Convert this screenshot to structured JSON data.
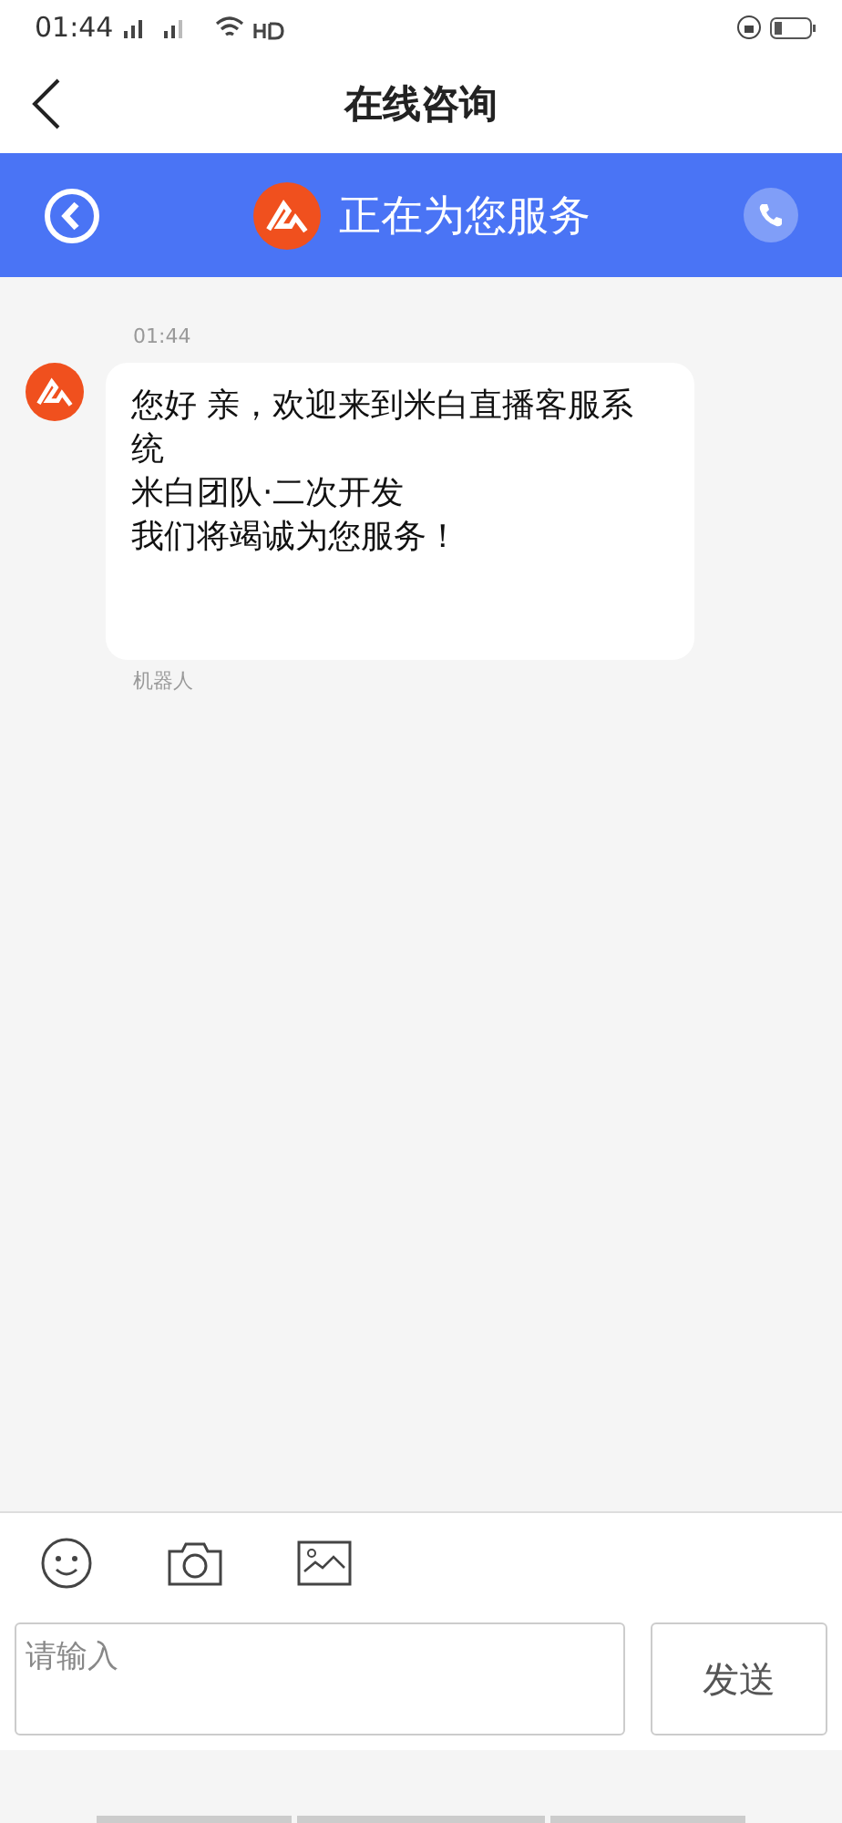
{
  "status_bar": {
    "time": "01:44"
  },
  "nav": {
    "title": "在线咨询"
  },
  "service_bar": {
    "title": "正在为您服务"
  },
  "messages": [
    {
      "time": "01:44",
      "lines": [
        "您好 亲，欢迎来到米白直播客服系统",
        "米白团队·二次开发",
        "我们将竭诚为您服务！"
      ],
      "sender": "机器人"
    }
  ],
  "composer": {
    "placeholder": "请输入",
    "send": "发送"
  }
}
